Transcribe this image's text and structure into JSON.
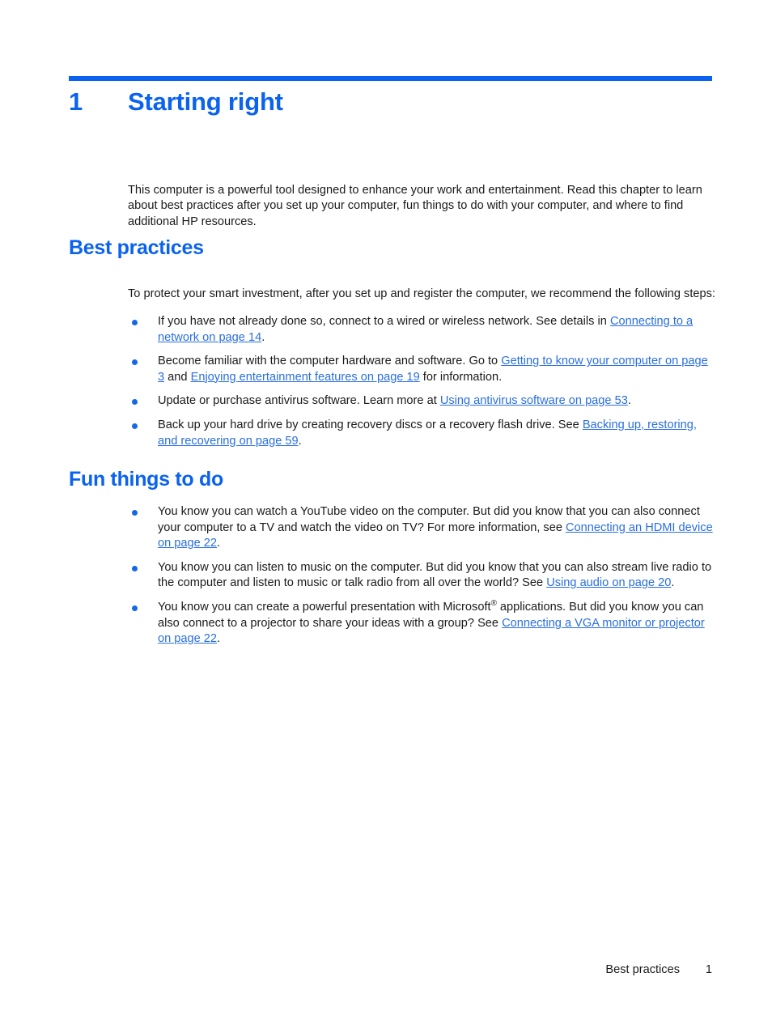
{
  "colors": {
    "heading_blue": "#0a62ef",
    "link_blue": "#2a6fe0",
    "bullet_blue": "#1467e8",
    "body_text": "#1a1a1a",
    "page_background": "#ffffff"
  },
  "chapter": {
    "number": "1",
    "title": "Starting right"
  },
  "intro": {
    "text": "This computer is a powerful tool designed to enhance your work and entertainment. Read this chapter to learn about best practices after you set up your computer, fun things to do with your computer, and where to find additional HP resources."
  },
  "sections": [
    {
      "heading": "Best practices",
      "lead": "To protect your smart investment, after you set up and register the computer, we recommend the following steps:",
      "bullets": [
        {
          "parts": [
            {
              "type": "text",
              "value": "If you have not already done so, connect to a wired or wireless network. See details in "
            },
            {
              "type": "link",
              "value": "Connecting to a network on page 14"
            },
            {
              "type": "text",
              "value": "."
            }
          ]
        },
        {
          "parts": [
            {
              "type": "text",
              "value": "Become familiar with the computer hardware and software. Go to "
            },
            {
              "type": "link",
              "value": "Getting to know your computer on page 3"
            },
            {
              "type": "text",
              "value": " and "
            },
            {
              "type": "link",
              "value": "Enjoying entertainment features on page 19"
            },
            {
              "type": "text",
              "value": " for information."
            }
          ]
        },
        {
          "parts": [
            {
              "type": "text",
              "value": "Update or purchase antivirus software. Learn more at "
            },
            {
              "type": "link",
              "value": "Using antivirus software on page 53"
            },
            {
              "type": "text",
              "value": "."
            }
          ]
        },
        {
          "parts": [
            {
              "type": "text",
              "value": "Back up your hard drive by creating recovery discs or a recovery flash drive. See "
            },
            {
              "type": "link",
              "value": "Backing up, restoring, and recovering on page 59"
            },
            {
              "type": "text",
              "value": "."
            }
          ]
        }
      ]
    },
    {
      "heading": "Fun things to do",
      "lead": "",
      "bullets": [
        {
          "parts": [
            {
              "type": "text",
              "value": "You know you can watch a YouTube video on the computer. But did you know that you can also connect your computer to a TV and watch the video on TV? For more information, see "
            },
            {
              "type": "link",
              "value": "Connecting an HDMI device on page 22"
            },
            {
              "type": "text",
              "value": "."
            }
          ]
        },
        {
          "parts": [
            {
              "type": "text",
              "value": "You know you can listen to music on the computer. But did you know that you can also stream live radio to the computer and listen to music or talk radio from all over the world? See "
            },
            {
              "type": "link",
              "value": "Using audio on page 20"
            },
            {
              "type": "text",
              "value": "."
            }
          ]
        },
        {
          "parts": [
            {
              "type": "text",
              "value": "You know you can create a powerful presentation with Microsoft"
            },
            {
              "type": "sup",
              "value": "®"
            },
            {
              "type": "text",
              "value": " applications. But did you know you can also connect to a projector to share your ideas with a group? See "
            },
            {
              "type": "link",
              "value": "Connecting a VGA monitor or projector on page 22"
            },
            {
              "type": "text",
              "value": "."
            }
          ]
        }
      ]
    }
  ],
  "footer": {
    "running_title": "Best practices",
    "page_number": "1"
  }
}
